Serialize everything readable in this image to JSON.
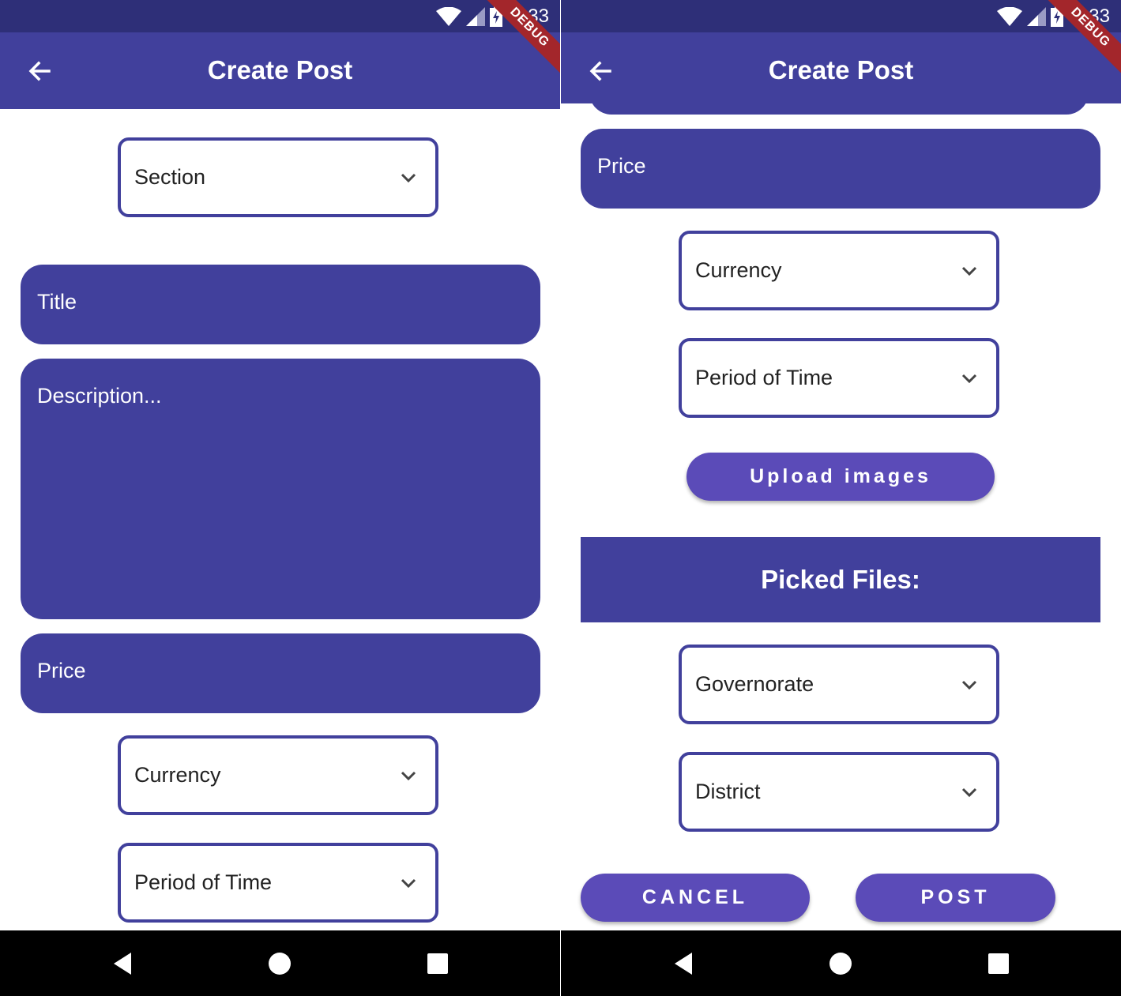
{
  "status": {
    "time": "3:33"
  },
  "debug_banner": "DEBUG",
  "left_screen": {
    "title": "Create Post",
    "section_dropdown": "Section",
    "title_field": "Title",
    "description_field": "Description...",
    "price_field": "Price",
    "currency_dropdown": "Currency",
    "period_dropdown": "Period of Time"
  },
  "right_screen": {
    "title": "Create Post",
    "price_field": "Price",
    "currency_dropdown": "Currency",
    "period_dropdown": "Period of Time",
    "upload_button": "Upload images",
    "picked_files_heading": "Picked Files:",
    "governorate_dropdown": "Governorate",
    "district_dropdown": "District",
    "cancel_button": "CANCEL",
    "post_button": "POST"
  },
  "colors": {
    "primary": "#41409c",
    "status_bar": "#2e2f78",
    "button": "#5b4bb8",
    "debug": "#a3262b"
  },
  "icons": [
    "back-arrow-icon",
    "wifi-icon",
    "signal-icon",
    "battery-icon",
    "chevron-down-icon",
    "nav-back-icon",
    "nav-home-icon",
    "nav-recents-icon"
  ]
}
